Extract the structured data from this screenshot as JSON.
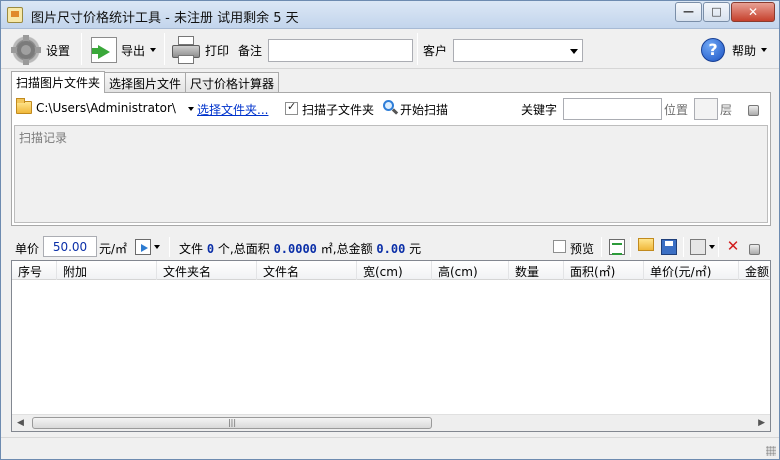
{
  "window": {
    "title": "图片尺寸价格统计工具 - 未注册 试用剩余 5 天",
    "minimize_glyph": "—",
    "maximize_glyph": "□",
    "close_glyph": "✕"
  },
  "toolbar": {
    "settings_label": "设置",
    "export_label": "导出",
    "print_label": "打印",
    "note_label": "备注",
    "note_value": "",
    "customer_label": "客户",
    "customer_value": "",
    "help_label": "帮助"
  },
  "tabs": [
    {
      "label": "扫描图片文件夹",
      "active": true
    },
    {
      "label": "选择图片文件",
      "active": false
    },
    {
      "label": "尺寸价格计算器",
      "active": false
    }
  ],
  "scan": {
    "path": "C:\\Users\\Administrator\\",
    "choose_folder_link": "选择文件夹...",
    "scan_subfolders_label": "扫描子文件夹",
    "scan_subfolders_checked": true,
    "start_scan_label": "开始扫描",
    "keyword_label": "关键字",
    "keyword_value": "",
    "position_label": "位置",
    "position_value": "",
    "layer_label": "层",
    "log_label": "扫描记录"
  },
  "pricebar": {
    "unit_price_label": "单价",
    "unit_price_value": "50.00",
    "unit_label": "元/㎡",
    "files_label": "文件",
    "files_count": "0",
    "files_unit": "个,总面积",
    "total_area": "0.0000",
    "area_unit": "㎡,总金额",
    "total_amount": "0.00",
    "currency": "元",
    "preview_label": "预览",
    "preview_checked": false
  },
  "table": {
    "columns": [
      "序号",
      "附加",
      "文件夹名",
      "文件名",
      "宽(cm)",
      "高(cm)",
      "数量",
      "面积(㎡)",
      "单价(元/㎡)",
      "金额"
    ],
    "rows": []
  },
  "scrollbar": {
    "left_arrow": "◀",
    "right_arrow": "▶",
    "thumb_grip": "|||"
  }
}
